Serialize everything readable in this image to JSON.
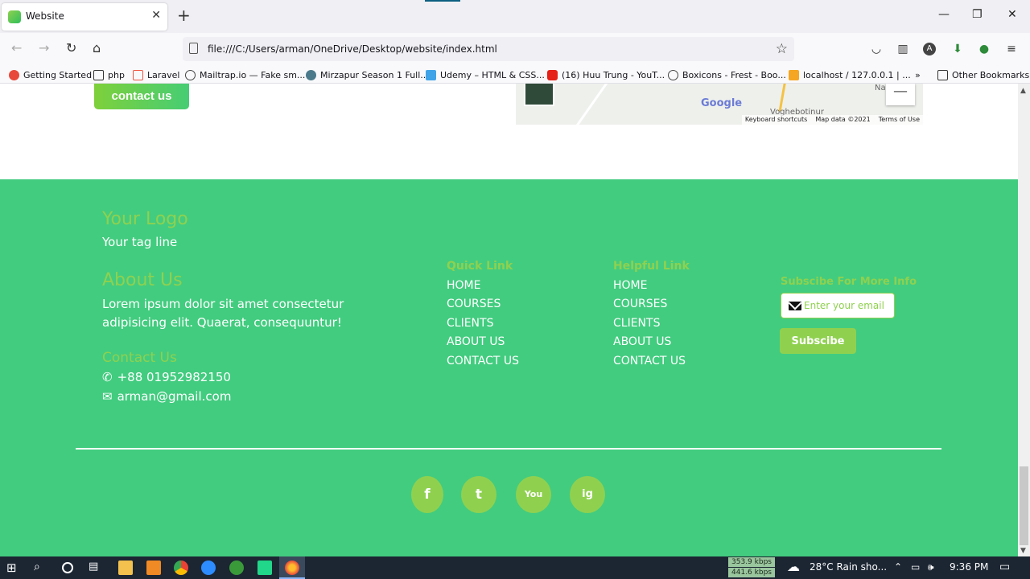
{
  "browser": {
    "tab_title": "Website",
    "url": "file:///C:/Users/arman/OneDrive/Desktop/website/index.html",
    "bookmarks": [
      "Getting Started",
      "php",
      "Laravel",
      "Mailtrap.io — Fake sm...",
      "Mirzapur Season 1 Full...",
      "Udemy – HTML & CSS...",
      "(16) Huu Trung - YouT...",
      "Boxicons - Frest - Boo...",
      "localhost / 127.0.0.1 | ...",
      "Other Bookmarks"
    ],
    "accent": "#0b5f80"
  },
  "hero": {
    "contact_label": "contact us"
  },
  "map": {
    "brand": "Google",
    "place_1": "Na",
    "place_2": "Voghebotinur",
    "zoom_out": "—",
    "footer_items": [
      "Keyboard shortcuts",
      "Map data ©2021",
      "Terms of Use"
    ]
  },
  "footer": {
    "logo": "Your Logo",
    "tagline": "Your tag line",
    "about_heading": "About Us",
    "about_text": "Lorem ipsum dolor sit amet consectetur adipisicing elit. Quaerat, consequuntur!",
    "contact_heading": "Contact Us",
    "phone": "+88 01952982150",
    "email": "arman@gmail.com",
    "quick_heading": "Quick Link",
    "quick_links": [
      "HOME",
      "COURSES",
      "CLIENTS",
      "ABOUT US",
      "CONTACT US"
    ],
    "helpful_heading": "Helpful Link",
    "helpful_links": [
      "HOME",
      "COURSES",
      "CLIENTS",
      "ABOUT US",
      "CONTACT US"
    ],
    "subscribe_heading": "Subscibe For More Info",
    "email_placeholder": "Enter your email",
    "subscribe_label": "Subscibe",
    "social": [
      "f",
      "t",
      "You",
      "ig"
    ],
    "bg_color": "#42cc7f",
    "accent_color": "#8fd14f"
  },
  "taskbar": {
    "net_up": "353.9 kbps",
    "net_down": "441.6 kbps",
    "weather": "28°C  Rain sho...",
    "time": "9:36 PM"
  }
}
